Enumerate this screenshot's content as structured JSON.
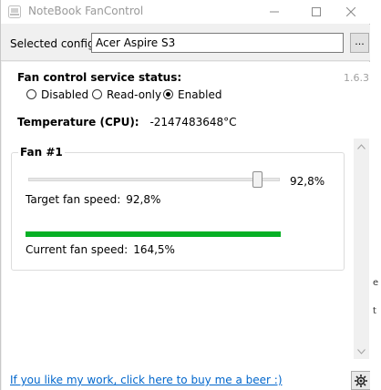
{
  "window": {
    "title": "NoteBook FanControl"
  },
  "config": {
    "label": "Selected config:",
    "value": "Acer Aspire S3",
    "browse_label": "..."
  },
  "version": "1.6.3",
  "service": {
    "label": "Fan control service status:",
    "options": [
      {
        "label": "Disabled",
        "checked": false
      },
      {
        "label": "Read-only",
        "checked": false
      },
      {
        "label": "Enabled",
        "checked": true
      }
    ]
  },
  "temperature": {
    "label": "Temperature (CPU):",
    "value": "-2147483648°C"
  },
  "fan": {
    "title": "Fan #1",
    "slider_percent": 92.8,
    "slider_value": "92,8%",
    "target_label": "Target fan speed:",
    "target_value": "92,8%",
    "current_label": "Current fan speed:",
    "current_value": "164,5%",
    "current_bar_percent": 100
  },
  "footer": {
    "donate_text": "If you like my work, click here to buy me a beer :)"
  },
  "background_fragments": [
    "e",
    "t"
  ],
  "colors": {
    "progress": "#06b025",
    "link": "#0066cc"
  }
}
